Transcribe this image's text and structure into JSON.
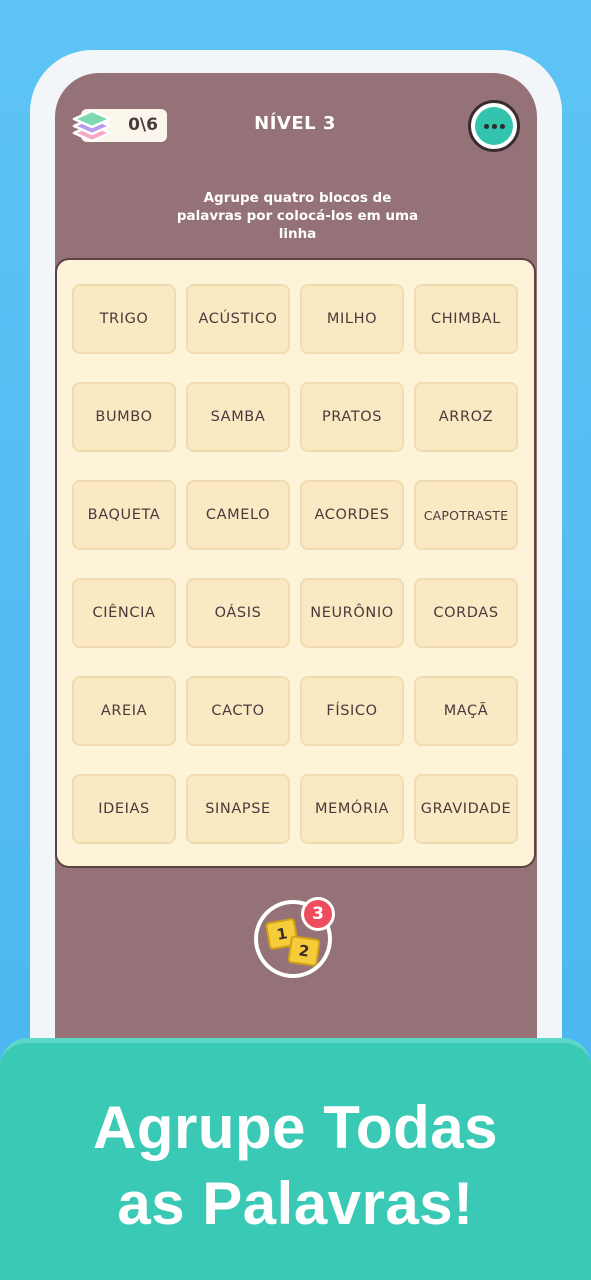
{
  "header": {
    "counter": "0\\6",
    "level_title": "NÍVEL 3",
    "menu_icon": "more-dots-icon",
    "counter_icon": "layers-icon"
  },
  "instructions": "Agrupe quatro blocos de palavras por colocá-los em uma linha",
  "board": {
    "rows": [
      [
        "TRIGO",
        "ACÚSTICO",
        "MILHO",
        "CHIMBAL"
      ],
      [
        "BUMBO",
        "SAMBA",
        "PRATOS",
        "ARROZ"
      ],
      [
        "BAQUETA",
        "CAMELO",
        "ACORDES",
        "CAPOTRASTE"
      ],
      [
        "CIÊNCIA",
        "OÁSIS",
        "NEURÔNIO",
        "CORDAS"
      ],
      [
        "AREIA",
        "CACTO",
        "FÍSICO",
        "MAÇÃ"
      ],
      [
        "IDEIAS",
        "SINAPSE",
        "MEMÓRIA",
        "GRAVIDADE"
      ]
    ]
  },
  "hint": {
    "tile_1": "1",
    "tile_2": "2",
    "badge_count": "3",
    "icon": "numbered-tiles-hint-icon"
  },
  "banner": {
    "line_1": "Agrupe Todas",
    "line_2": "as Palavras!"
  },
  "colors": {
    "background": "#48b4ef",
    "screen": "#957277",
    "board": "#fdf3d9",
    "tile": "#fbe9c4",
    "accent": "#33c4ad",
    "badge": "#ef4d5d",
    "banner": "#3ac9b5"
  }
}
